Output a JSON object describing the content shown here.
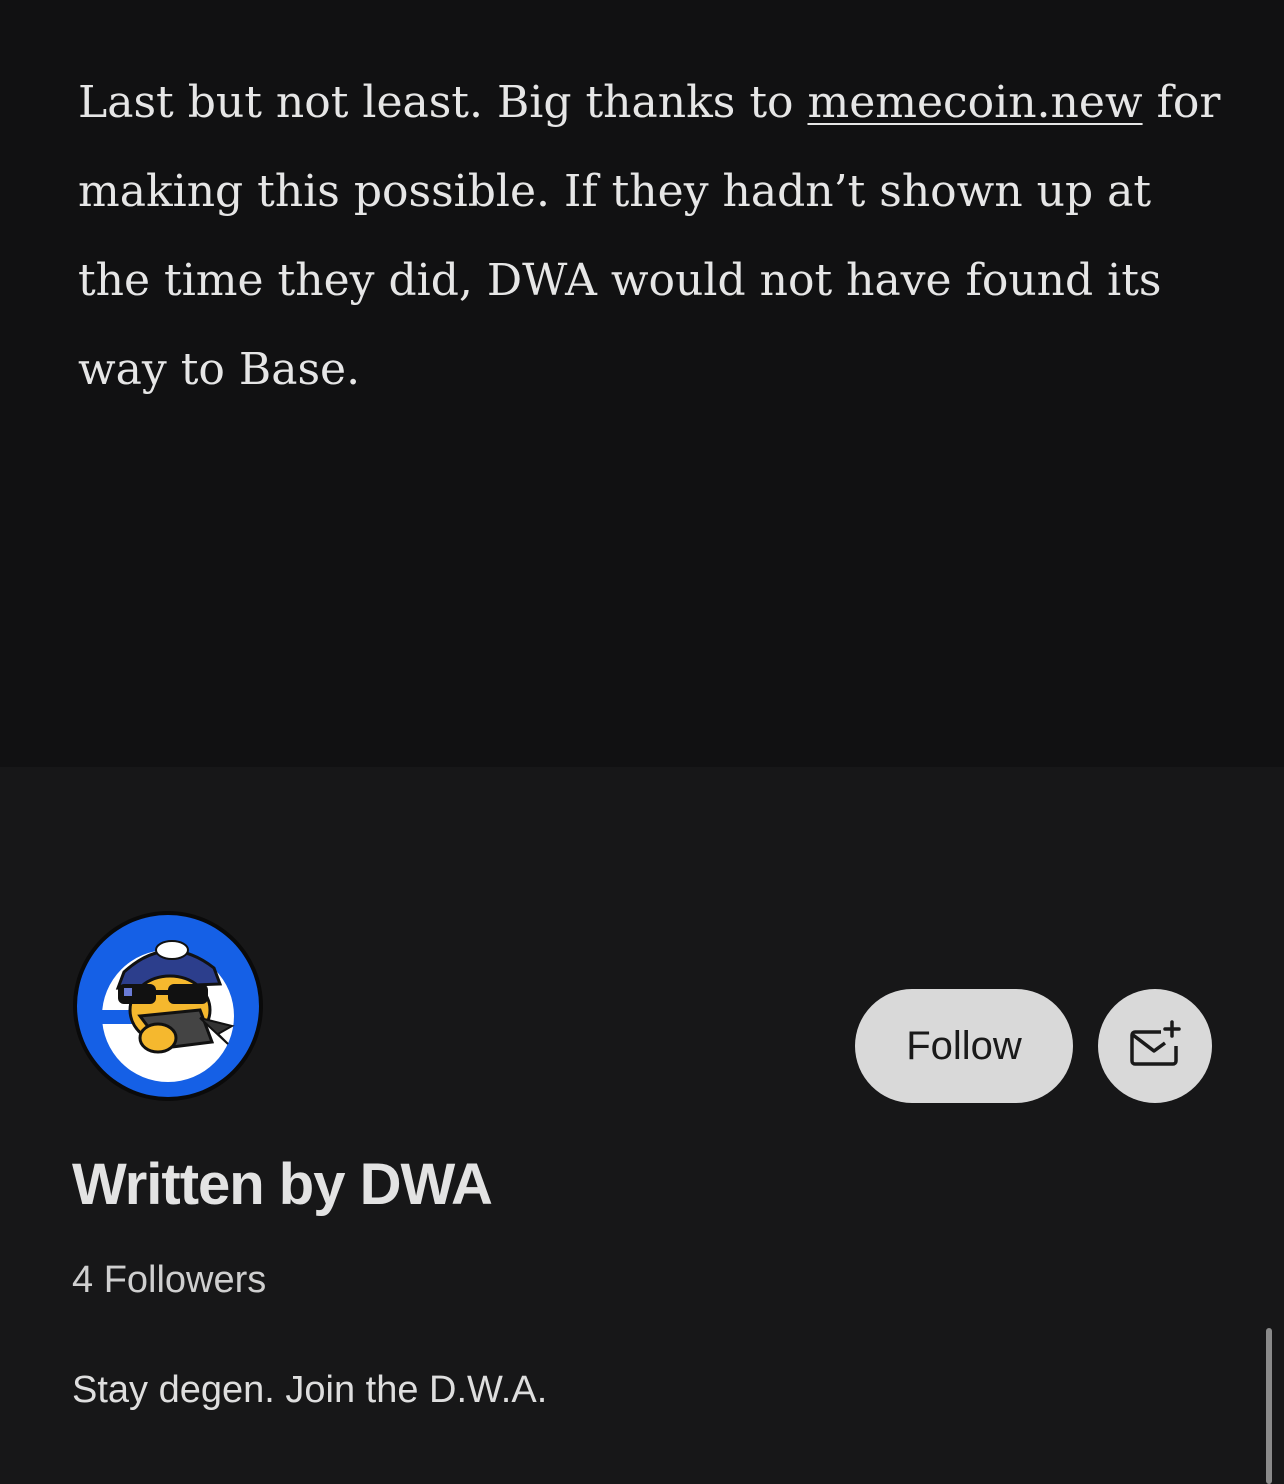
{
  "article": {
    "text_before_link": "Last but not least. Big thanks to ",
    "link_text": "memecoin.new",
    "text_after_link": " for making this possible. If they hadn’t shown up at the time they did, DWA would not have found its way to Base."
  },
  "author": {
    "avatar_label": "DWA",
    "written_by": "Written by DWA",
    "followers": "4 Followers",
    "bio": "Stay degen. Join the D.W.A.",
    "follow_label": "Follow",
    "subscribe_icon": "mail-plus-icon"
  },
  "colors": {
    "background": "#111112",
    "author_section": "#171718",
    "button": "#d9d9d9",
    "avatar_blue": "#1560e6"
  }
}
